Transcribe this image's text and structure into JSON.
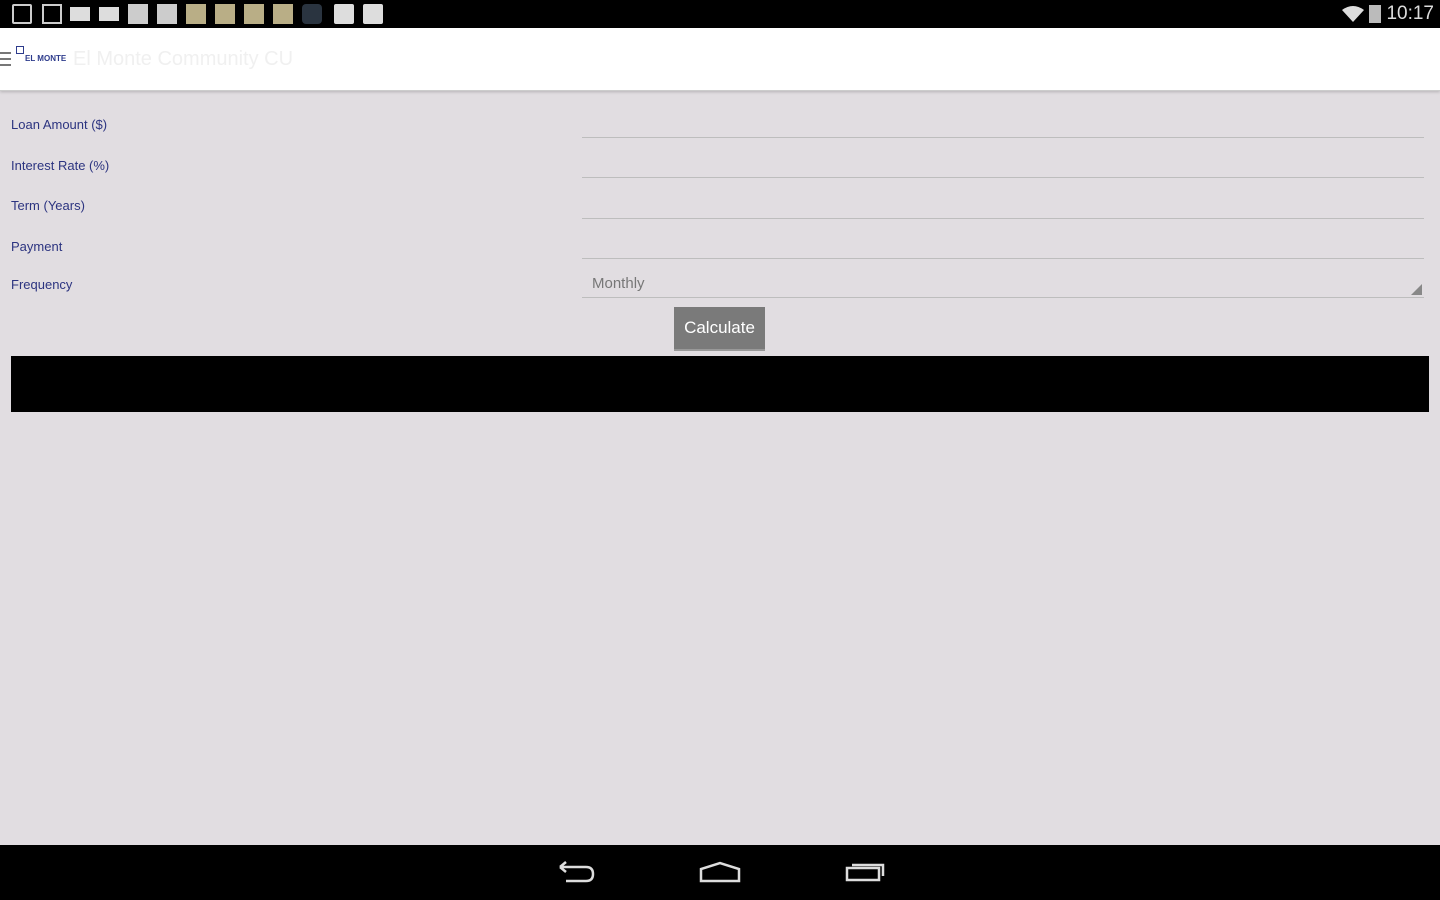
{
  "status_bar": {
    "time": "10:17",
    "icons": [
      "download-icon",
      "image-icon",
      "mail-icon",
      "mail-icon",
      "app-icon",
      "app-icon",
      "app-icon",
      "app-icon",
      "app-icon",
      "app-icon",
      "app-icon",
      "checkbag-icon",
      "play-store-icon"
    ]
  },
  "app_bar": {
    "logo_text": "EL MONTE",
    "title": "El Monte Community CU"
  },
  "form": {
    "fields": [
      {
        "label": "Loan Amount ($)",
        "value": ""
      },
      {
        "label": "Interest Rate (%)",
        "value": ""
      },
      {
        "label": "Term (Years)",
        "value": ""
      },
      {
        "label": "Payment",
        "value": ""
      }
    ],
    "frequency": {
      "label": "Frequency",
      "selected": "Monthly"
    },
    "calculate_label": "Calculate"
  },
  "result": ""
}
